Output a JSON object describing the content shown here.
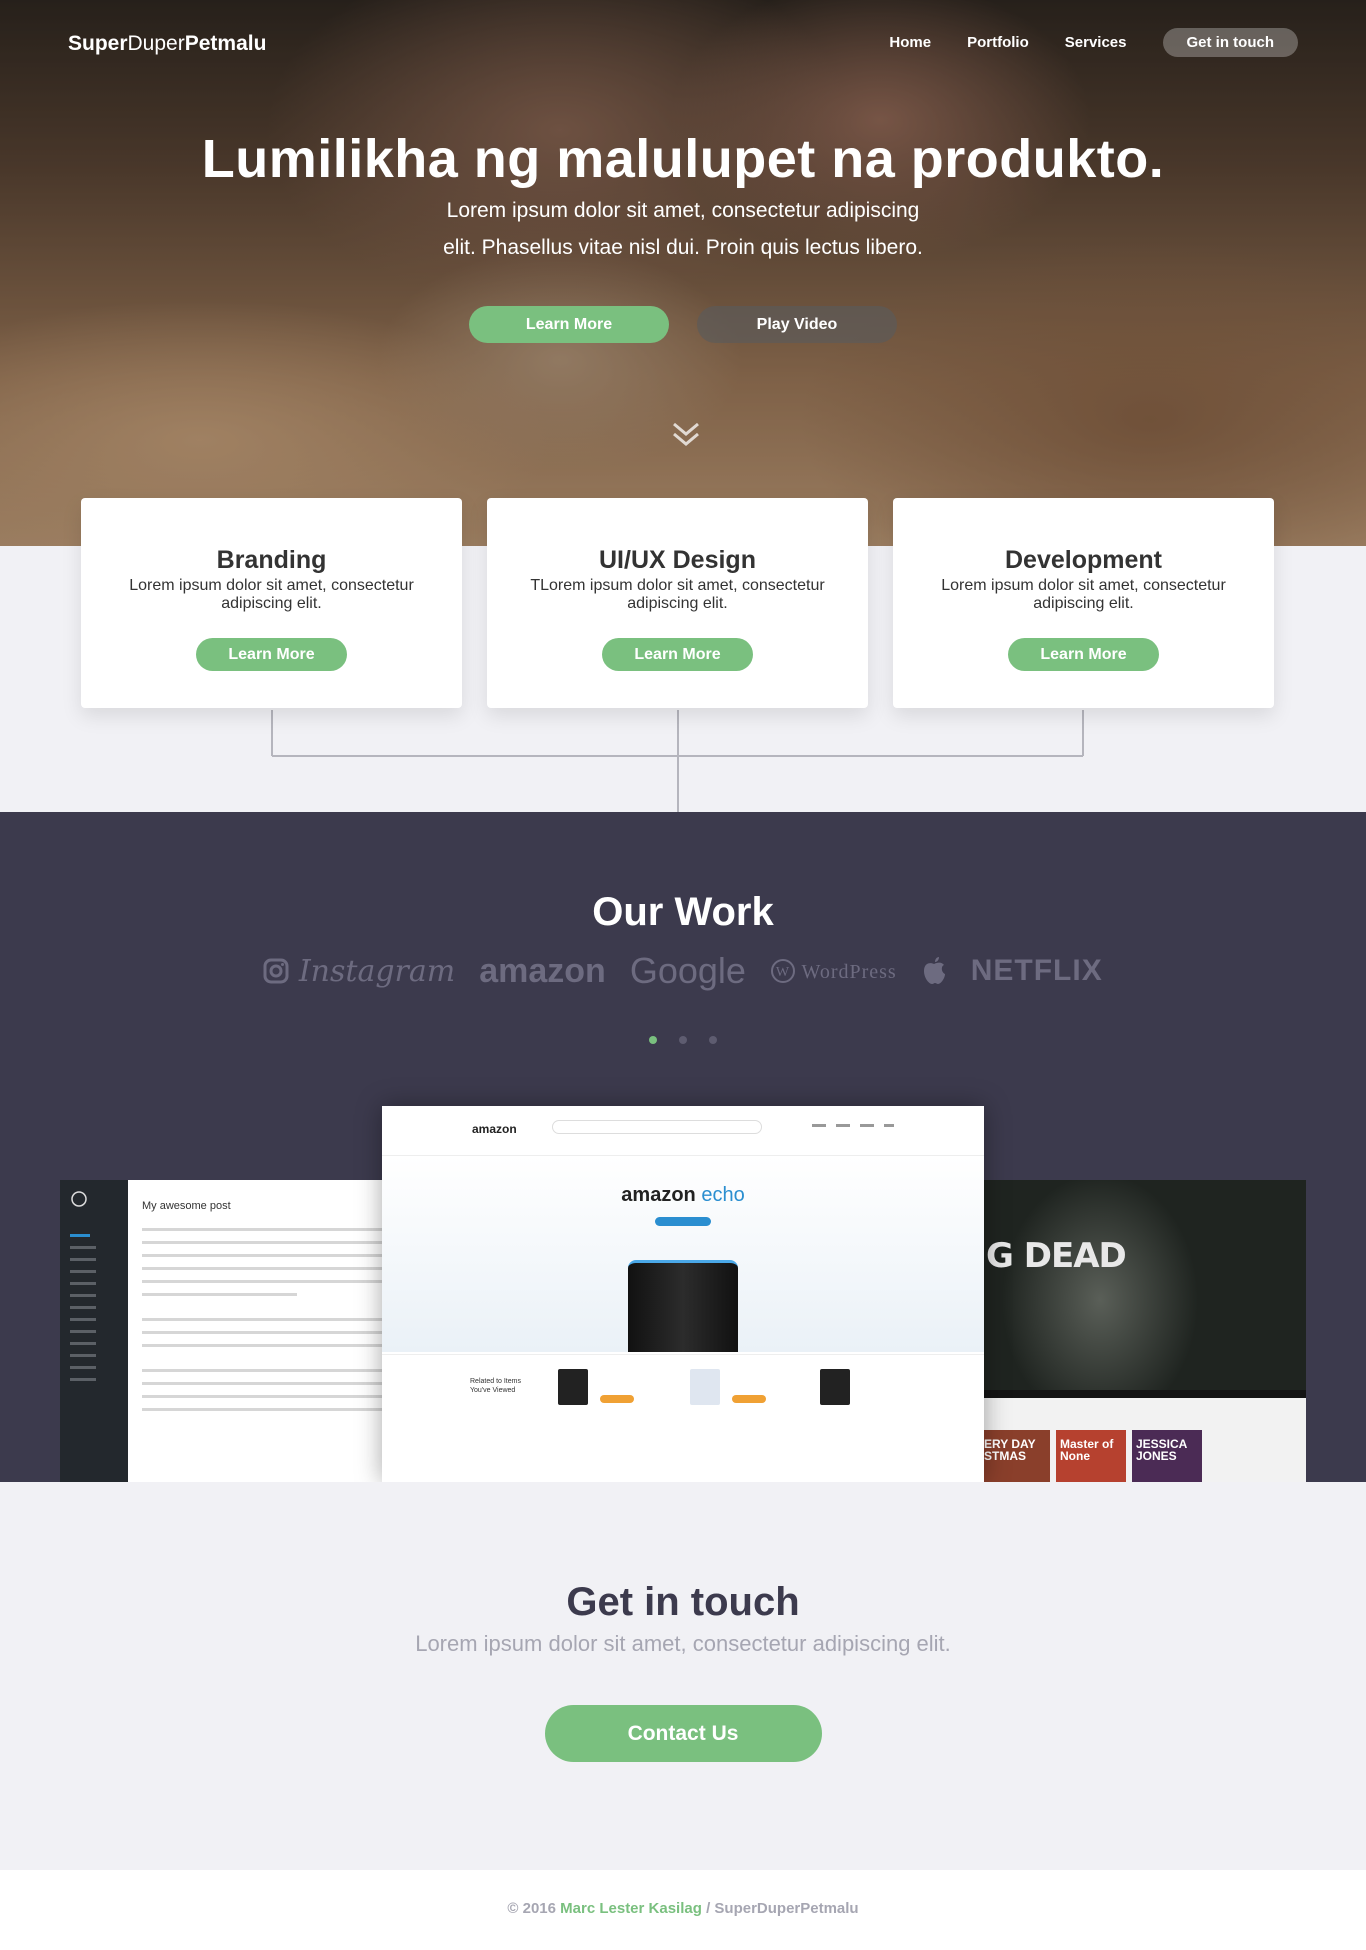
{
  "nav": {
    "logo_bold": "Super",
    "logo_thin": "Duper",
    "logo_bold2": "Petmalu",
    "links": [
      "Home",
      "Portfolio",
      "Services"
    ],
    "cta": "Get in touch"
  },
  "hero": {
    "title": "Lumilikha ng malulupet na produkto.",
    "subtitle": "Lorem ipsum dolor sit amet, consectetur adipiscing elit. Phasellus vitae nisl dui. Proin quis lectus libero.",
    "primary_button": "Learn More",
    "secondary_button": "Play Video"
  },
  "cards": [
    {
      "title": "Branding",
      "text": "Lorem ipsum dolor sit amet, consectetur adipiscing elit.",
      "button": "Learn More"
    },
    {
      "title": "UI/UX Design",
      "text": "TLorem ipsum dolor sit amet, consectetur adipiscing elit.",
      "button": "Learn More"
    },
    {
      "title": "Development",
      "text": "Lorem ipsum dolor sit amet, consectetur adipiscing elit.",
      "button": "Learn More"
    }
  ],
  "work": {
    "title": "Our Work",
    "brands": [
      "Instagram",
      "amazon",
      "Google",
      "WordPress",
      "NETFLIX"
    ],
    "carousel_dots": 3,
    "active_dot": 1,
    "wp_post_title": "My awesome post",
    "amz_logo": "amazon",
    "amz_product": "amazon",
    "amz_product_accent": "echo",
    "amz_related": "Related to Items You've Viewed",
    "nf_title": "G DEAD",
    "nf_tiles": [
      "ERY DAY STMAS",
      "Master of None",
      "JESSICA JONES"
    ]
  },
  "contact": {
    "title": "Get in touch",
    "subtitle": "Lorem ipsum dolor sit amet, consectetur adipiscing elit.",
    "button": "Contact Us"
  },
  "footer": {
    "prefix": "© 2016",
    "author": "Marc Lester Kasilag",
    "suffix": "/ SuperDuperPetmalu"
  },
  "colors": {
    "accent": "#7ac07f",
    "dark": "#3c3a4d",
    "muted": "#a6a6b2"
  }
}
